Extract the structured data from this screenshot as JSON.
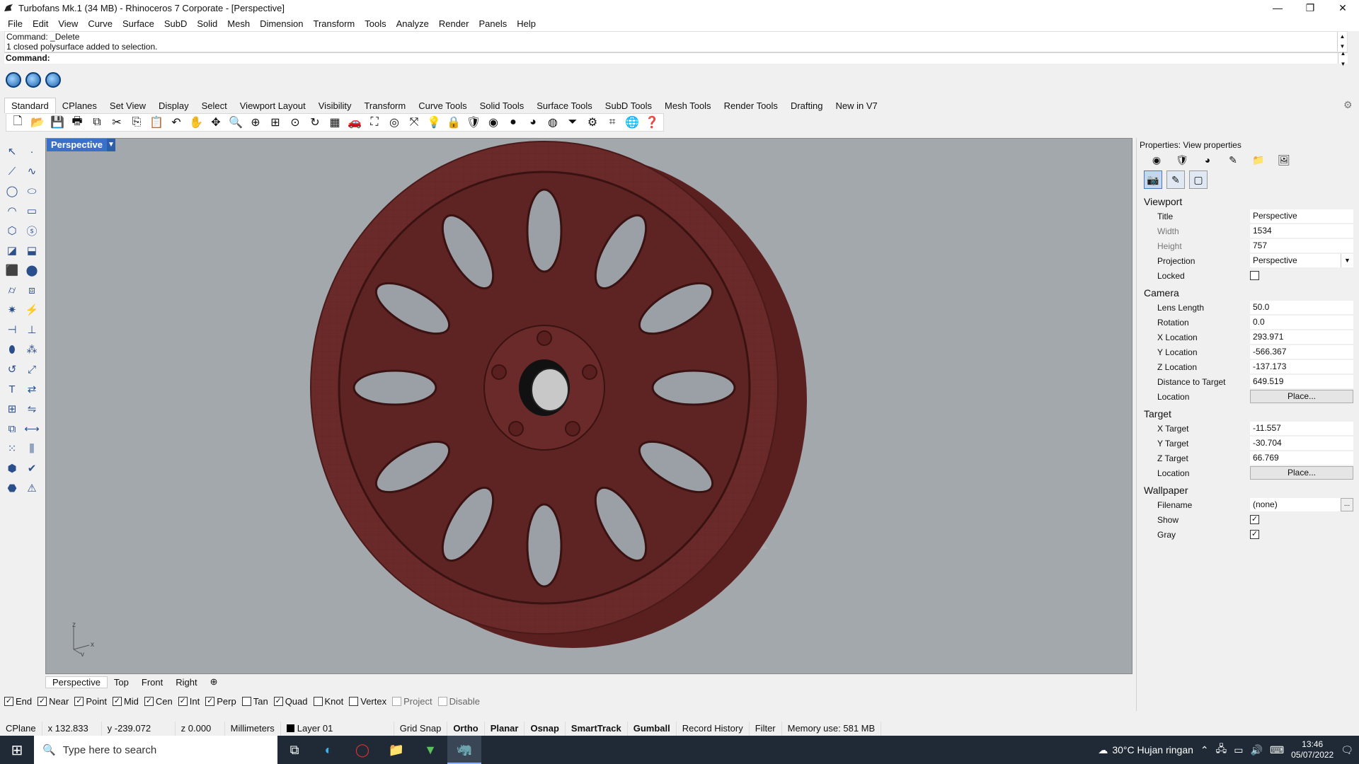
{
  "window": {
    "title": "Turbofans Mk.1 (34 MB) - Rhinoceros 7 Corporate - [Perspective]",
    "minimize": "—",
    "restore": "❐",
    "close": "✕"
  },
  "menu": [
    "File",
    "Edit",
    "View",
    "Curve",
    "Surface",
    "SubD",
    "Solid",
    "Mesh",
    "Dimension",
    "Transform",
    "Tools",
    "Analyze",
    "Render",
    "Panels",
    "Help"
  ],
  "command": {
    "history_line1": "Command: _Delete",
    "history_line2": "1 closed polysurface added to selection.",
    "prompt": "Command:"
  },
  "toolbar_tabs": [
    "Standard",
    "CPlanes",
    "Set View",
    "Display",
    "Select",
    "Viewport Layout",
    "Visibility",
    "Transform",
    "Curve Tools",
    "Solid Tools",
    "Surface Tools",
    "SubD Tools",
    "Mesh Tools",
    "Render Tools",
    "Drafting",
    "New in V7"
  ],
  "active_toolbar_tab": "Standard",
  "viewport": {
    "label": "Perspective",
    "axis_z": "z",
    "axis_x": "x",
    "axis_y": "y",
    "model_color": "#6b2a2a",
    "background": "#a3a8ad"
  },
  "viewport_tabs": [
    "Perspective",
    "Top",
    "Front",
    "Right"
  ],
  "osnaps": [
    {
      "label": "End",
      "checked": true,
      "enabled": true
    },
    {
      "label": "Near",
      "checked": true,
      "enabled": true
    },
    {
      "label": "Point",
      "checked": true,
      "enabled": true
    },
    {
      "label": "Mid",
      "checked": true,
      "enabled": true
    },
    {
      "label": "Cen",
      "checked": true,
      "enabled": true
    },
    {
      "label": "Int",
      "checked": true,
      "enabled": true
    },
    {
      "label": "Perp",
      "checked": true,
      "enabled": true
    },
    {
      "label": "Tan",
      "checked": false,
      "enabled": true
    },
    {
      "label": "Quad",
      "checked": true,
      "enabled": true
    },
    {
      "label": "Knot",
      "checked": false,
      "enabled": true
    },
    {
      "label": "Vertex",
      "checked": false,
      "enabled": true
    },
    {
      "label": "Project",
      "checked": false,
      "enabled": false
    },
    {
      "label": "Disable",
      "checked": false,
      "enabled": false
    }
  ],
  "status": {
    "cplane": "CPlane",
    "x": "x 132.833",
    "y": "y -239.072",
    "z": "z 0.000",
    "units": "Millimeters",
    "layer": "Layer 01",
    "grid_snap": "Grid Snap",
    "ortho": "Ortho",
    "planar": "Planar",
    "osnap": "Osnap",
    "smarttrack": "SmartTrack",
    "gumball": "Gumball",
    "record_history": "Record History",
    "filter": "Filter",
    "memory": "Memory use: 581 MB"
  },
  "properties": {
    "title": "Properties: View properties",
    "viewport_section": "Viewport",
    "title_label": "Title",
    "title_value": "Perspective",
    "width_label": "Width",
    "width_value": "1534",
    "height_label": "Height",
    "height_value": "757",
    "projection_label": "Projection",
    "projection_value": "Perspective",
    "locked_label": "Locked",
    "locked": false,
    "camera_section": "Camera",
    "lens_label": "Lens Length",
    "lens_value": "50.0",
    "rotation_label": "Rotation",
    "rotation_value": "0.0",
    "xloc_label": "X Location",
    "xloc_value": "293.971",
    "yloc_label": "Y Location",
    "yloc_value": "-566.367",
    "zloc_label": "Z Location",
    "zloc_value": "-137.173",
    "dist_label": "Distance to Target",
    "dist_value": "649.519",
    "loc_label": "Location",
    "place_button": "Place...",
    "target_section": "Target",
    "xt_label": "X Target",
    "xt_value": "-11.557",
    "yt_label": "Y Target",
    "yt_value": "-30.704",
    "zt_label": "Z Target",
    "zt_value": "66.769",
    "tloc_label": "Location",
    "tplace_button": "Place...",
    "wallpaper_section": "Wallpaper",
    "filename_label": "Filename",
    "filename_value": "(none)",
    "browse_button": "...",
    "show_label": "Show",
    "show": true,
    "gray_label": "Gray",
    "gray": true
  },
  "taskbar": {
    "search_placeholder": "Type here to search",
    "weather": "30°C  Hujan ringan",
    "time": "13:46",
    "date": "05/07/2022"
  }
}
